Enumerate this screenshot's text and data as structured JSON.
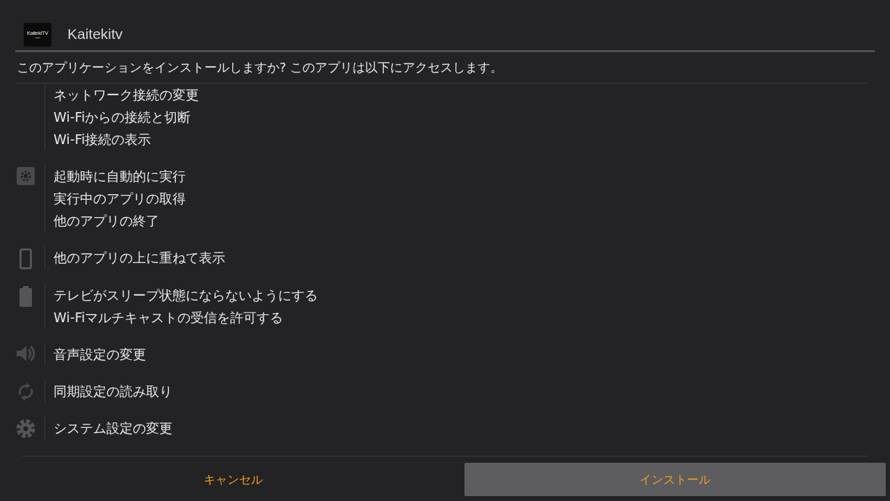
{
  "app": {
    "logo_text": "KaitekiTV",
    "title": "Kaitekitv"
  },
  "prompt": "このアプリケーションをインストールしますか? このアプリは以下にアクセスします。",
  "permission_groups": [
    {
      "permissions": [
        "ネットワーク接続の変更",
        "Wi-Fiからの接続と切断",
        "Wi-Fi接続の表示"
      ]
    },
    {
      "kind": "settings-square",
      "permissions": [
        "起動時に自動的に実行",
        "実行中のアプリの取得",
        "他のアプリの終了"
      ]
    },
    {
      "kind": "phone",
      "permissions": [
        "他のアプリの上に重ねて表示"
      ]
    },
    {
      "kind": "battery",
      "permissions": [
        "テレビがスリープ状態にならないようにする",
        "Wi-Fiマルチキャストの受信を許可する"
      ]
    },
    {
      "kind": "speaker",
      "permissions": [
        "音声設定の変更"
      ]
    },
    {
      "kind": "sync",
      "permissions": [
        "同期設定の読み取り"
      ]
    },
    {
      "kind": "gear",
      "permissions": [
        "システム設定の変更"
      ]
    }
  ],
  "buttons": [
    {
      "label": "キャンセル",
      "selected": false
    },
    {
      "label": "インストール",
      "selected": true
    }
  ]
}
